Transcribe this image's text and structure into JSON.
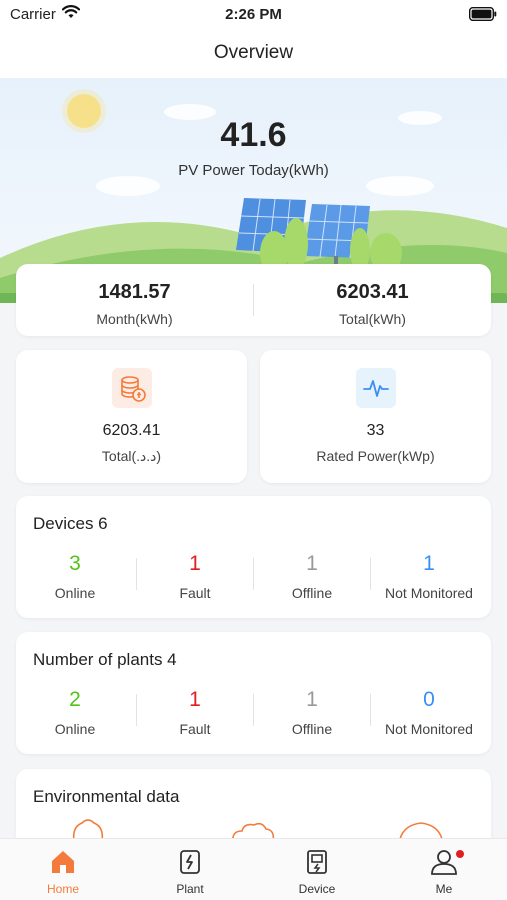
{
  "status_bar": {
    "carrier": "Carrier",
    "time": "2:26 PM"
  },
  "nav": {
    "title": "Overview"
  },
  "hero": {
    "value": "41.6",
    "label": "PV Power Today(kWh)"
  },
  "totals": {
    "month": {
      "value": "1481.57",
      "label": "Month(kWh)"
    },
    "total": {
      "value": "6203.41",
      "label": "Total(kWh)"
    }
  },
  "income": {
    "value": "6203.41",
    "label": "Total(.ﺩ.ﺩ)",
    "icon": "coins-icon"
  },
  "rated": {
    "value": "33",
    "label": "Rated Power(kWp)",
    "icon": "pulse-icon"
  },
  "devices": {
    "heading": "Devices 6",
    "stats": [
      {
        "value": "1",
        "label": "Fault"
      },
      {
        "value": "3",
        "label": "Online"
      },
      {
        "value": "1",
        "label": "Offline"
      },
      {
        "value": "1",
        "label": "Not Monitored"
      }
    ]
  },
  "plants": {
    "heading": "Number of plants 4",
    "stats": [
      {
        "value": "2",
        "label": "Online"
      },
      {
        "value": "1",
        "label": "Fault"
      },
      {
        "value": "1",
        "label": "Offline"
      },
      {
        "value": "0",
        "label": "Not Monitored"
      }
    ]
  },
  "environment": {
    "heading": "Environmental data"
  },
  "tabs": [
    {
      "label": "Home",
      "icon": "home-icon",
      "active": true
    },
    {
      "label": "Plant",
      "icon": "plant-icon",
      "active": false
    },
    {
      "label": "Device",
      "icon": "device-icon",
      "active": false
    },
    {
      "label": "Me",
      "icon": "person-icon",
      "active": false
    }
  ],
  "colors": {
    "accent": "#f47b3b",
    "online": "#52c41a",
    "fault": "#e02020",
    "offline": "#999999",
    "not_monitored": "#3b8ff3"
  }
}
